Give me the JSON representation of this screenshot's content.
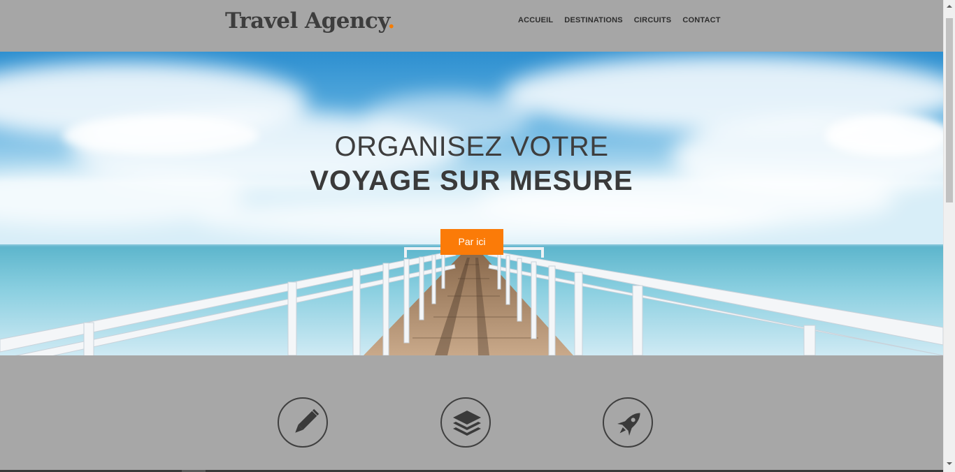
{
  "header": {
    "logo_text": "Travel Agency",
    "logo_dot": ".",
    "nav": [
      {
        "label": "ACCUEIL"
      },
      {
        "label": "DESTINATIONS"
      },
      {
        "label": "CIRCUITS"
      },
      {
        "label": "CONTACT"
      }
    ]
  },
  "hero": {
    "line1": "ORGANISEZ VOTRE",
    "line2": "VOYAGE SUR MESURE",
    "cta_label": "Par ici"
  },
  "features": {
    "icons": [
      "pencil-icon",
      "layers-icon",
      "rocket-icon"
    ]
  },
  "colors": {
    "accent": "#fb7b08",
    "overlay_gray": "#a7a7a7",
    "text_dark": "#3d3d3d"
  }
}
